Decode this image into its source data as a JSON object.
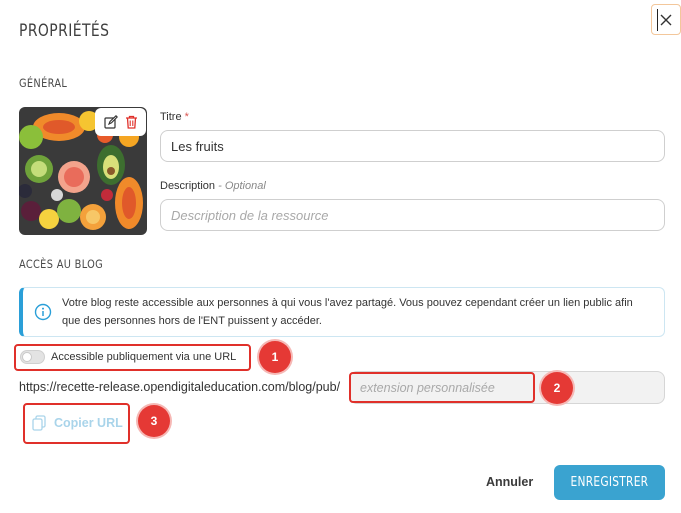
{
  "modal": {
    "title": "PROPRIÉTÉS",
    "close_icon": "close-icon"
  },
  "general": {
    "section_title": "GÉNÉRAL",
    "thumbnail_icons": [
      "edit-icon",
      "trash-icon"
    ],
    "title_label": "Titre",
    "title_required_mark": "*",
    "title_value": "Les fruits",
    "description_label": "Description",
    "description_optional": "- Optional",
    "description_placeholder": "Description de la ressource"
  },
  "access": {
    "section_title": "ACCÈS AU BLOG",
    "info_icon": "info-icon",
    "info_text": "Votre blog reste accessible aux personnes à qui vous l'avez partagé. Vous pouvez cependant créer un lien public afin que des personnes hors de l'ENT puissent y accéder.",
    "toggle_label": "Accessible publiquement via une URL",
    "toggle_on": false,
    "url_prefix": "https://recette-release.opendigitaleducation.com/blog/pub/",
    "extension_placeholder": "extension personnalisée",
    "copy_label": "Copier URL",
    "copy_icon": "copy-icon"
  },
  "annotations": [
    "1",
    "2",
    "3"
  ],
  "footer": {
    "cancel_label": "Annuler",
    "save_label": "ENREGISTRER"
  },
  "colors": {
    "primary": "#3aa3d0",
    "annotation_red": "#e53935",
    "info_accent": "#2a9fd8",
    "required": "#d9534f"
  }
}
